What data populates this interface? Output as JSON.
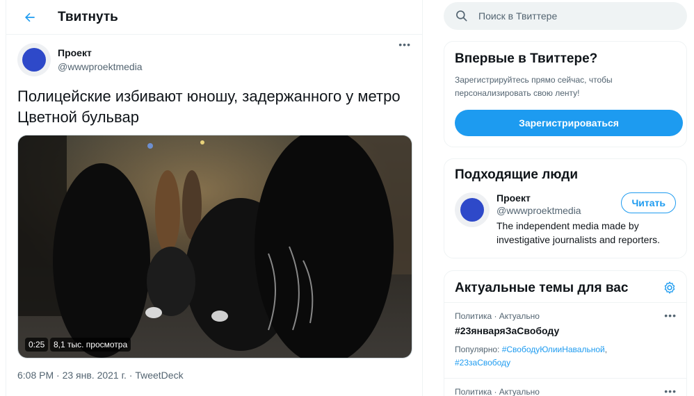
{
  "header": {
    "title": "Твитнуть"
  },
  "tweet": {
    "author_name": "Проект",
    "author_handle": "@wwwproektmedia",
    "text": "Полицейские избивают юношу, задержанного у метро Цветной бульвар",
    "video": {
      "duration": "0:25",
      "views": "8,1 тыс. просмотра"
    },
    "meta": "6:08 PM · 23 янв. 2021 г. · TweetDeck"
  },
  "search": {
    "placeholder": "Поиск в Твиттере"
  },
  "new_to_twitter": {
    "title": "Впервые в Твиттере?",
    "description": "Зарегистрируйтесь прямо сейчас, чтобы персонализировать свою ленту!",
    "signup_label": "Зарегистрироваться"
  },
  "who_to_follow": {
    "title": "Подходящие люди",
    "person": {
      "name": "Проект",
      "handle": "@wwwproektmedia",
      "bio": "The independent media made by investigative journalists and reporters.",
      "follow_label": "Читать"
    }
  },
  "trends": {
    "title": "Актуальные темы для вас",
    "items": [
      {
        "category": "Политика · Актуально",
        "name": "#23январяЗаСвободу",
        "popular_label": "Популярно:",
        "popular_1": "#СвободуЮлииНавальной",
        "popular_2": "#23заСвободу"
      },
      {
        "category": "Политика · Актуально"
      }
    ]
  },
  "icons": {
    "back": "arrow-left-icon",
    "more": "more-horizontal-icon",
    "search": "search-icon",
    "settings": "gear-icon"
  },
  "colors": {
    "accent": "#1d9bf0",
    "avatar": "#2e49c9",
    "text": "#0f1419",
    "secondary": "#536471"
  }
}
